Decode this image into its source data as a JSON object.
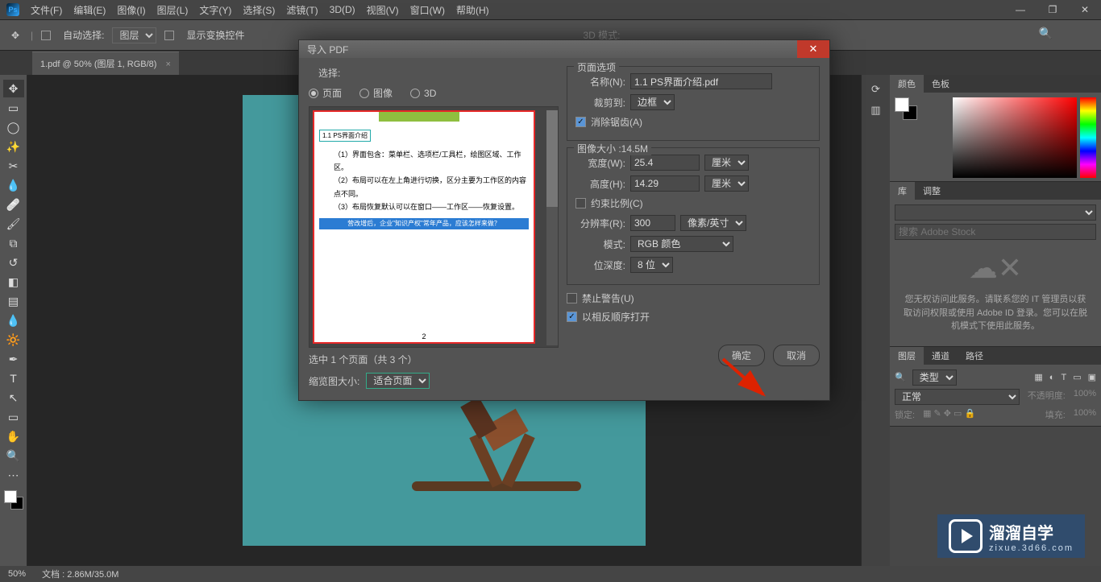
{
  "menu": {
    "items": [
      "文件(F)",
      "编辑(E)",
      "图像(I)",
      "图层(L)",
      "文字(Y)",
      "选择(S)",
      "滤镜(T)",
      "3D(D)",
      "视图(V)",
      "窗口(W)",
      "帮助(H)"
    ]
  },
  "options": {
    "auto_select": "自动选择:",
    "layer_dd": "图层",
    "show_transform": "显示变换控件",
    "mode3d": "3D 模式:"
  },
  "doctab": {
    "label": "1.pdf @ 50% (图层 1, RGB/8)"
  },
  "status": {
    "zoom": "50%",
    "doc": "文档 : 2.86M/35.0M"
  },
  "rightpanels": {
    "color": {
      "tab1": "颜色",
      "tab2": "色板"
    },
    "lib": {
      "tab1": "库",
      "tab2": "调整",
      "search_ph": "搜索 Adobe Stock",
      "msg": "您无权访问此服务。请联系您的 IT 管理员以获取访问权限或使用 Adobe ID 登录。您可以在脱机模式下使用此服务。"
    },
    "layers": {
      "tab1": "图层",
      "tab2": "通道",
      "tab3": "路径",
      "kind": "类型",
      "blend": "正常",
      "opacity_lbl": "不透明度:",
      "opacity": "100%",
      "lock_lbl": "锁定:",
      "fill_lbl": "填充:",
      "fill": "100%"
    }
  },
  "dialog": {
    "title": "导入 PDF",
    "select_label": "选择:",
    "radios": {
      "page": "页面",
      "image": "图像",
      "threeD": "3D"
    },
    "thumb": {
      "pagenum": "2",
      "title": "1.1 PS界面介绍",
      "l1": "（1）界面包含：菜单栏、选项栏/工具栏，绘图区域、工作区。",
      "l2": "（2）布局可以在左上角进行切换，区分主要为工作区的内容点不同。",
      "l3": "（3）布局恢复默认可以在窗口——工作区——恢复设置。",
      "blue": "营改增后，企业\"知识产权\"常年产品，应该怎样来做？"
    },
    "sel_info": "选中 1 个页面（共 3 个）",
    "thumb_size_lbl": "缩览图大小:",
    "thumb_size": "适合页面",
    "pageopt": {
      "group": "页面选项",
      "name_lbl": "名称(N):",
      "name": "1.1 PS界面介绍.pdf",
      "crop_lbl": "裁剪到:",
      "crop": "边框",
      "antialias": "消除锯齿(A)"
    },
    "imgsize": {
      "group": "图像大小 :14.5M",
      "w_lbl": "宽度(W):",
      "w": "25.4",
      "w_unit": "厘米",
      "h_lbl": "高度(H):",
      "h": "14.29",
      "h_unit": "厘米",
      "constrain": "约束比例(C)",
      "res_lbl": "分辨率(R):",
      "res": "300",
      "res_unit": "像素/英寸",
      "mode_lbl": "模式:",
      "mode": "RGB 颜色",
      "depth_lbl": "位深度:",
      "depth": "8 位"
    },
    "suppress": "禁止警告(U)",
    "reverse": "以相反顺序打开",
    "ok": "确定",
    "cancel": "取消"
  },
  "watermark": {
    "title": "溜溜自学",
    "sub": "zixue.3d66.com"
  }
}
